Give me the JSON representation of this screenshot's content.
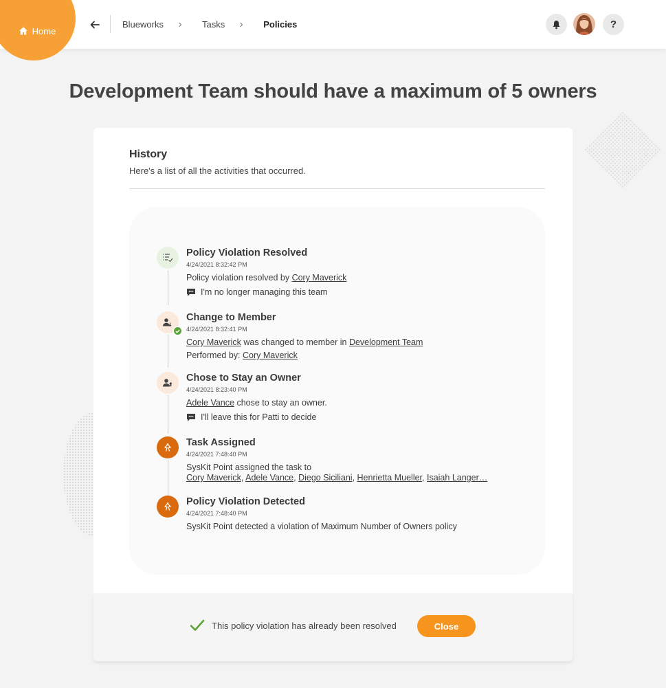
{
  "header": {
    "home_label": "Home",
    "breadcrumbs": [
      "Blueworks",
      "Tasks",
      "Policies"
    ],
    "help_label": "?"
  },
  "page": {
    "title": "Development Team should have a maximum of 5 owners"
  },
  "history": {
    "title": "History",
    "subtitle": "Here's a list of all the activities that occurred.",
    "events": [
      {
        "title": "Policy Violation Resolved",
        "time": "4/24/2021 8:32:42 PM",
        "text": "Policy violation resolved by",
        "user": "Cory Maverick",
        "comment": "I'm no longer managing this team",
        "icon": "policy-list-check-icon"
      },
      {
        "title": "Change to Member",
        "time": "4/24/2021 8:32:41 PM",
        "user": "Cory Maverick",
        "text": "was changed to member in",
        "team": "Development Team",
        "performed_label": "Performed by:",
        "performed_user": "Cory Maverick",
        "icon": "user-change-icon"
      },
      {
        "title": "Chose to Stay an Owner",
        "time": "4/24/2021 8:23:40 PM",
        "user": "Adele Vance",
        "text": "chose to stay an owner.",
        "comment": "I'll leave this for Patti to decide",
        "icon": "user-owner-icon"
      },
      {
        "title": "Task Assigned",
        "time": "4/24/2021 7:48:40 PM",
        "text": "SysKit Point assigned the task to",
        "users": [
          "Cory Maverick",
          "Adele Vance",
          "Diego Siciliani",
          "Henrietta Mueller",
          "Isaiah Langer…"
        ],
        "icon": "syskit-icon"
      },
      {
        "title": "Policy Violation Detected",
        "time": "4/24/2021 7:48:40 PM",
        "text": "SysKit Point detected a violation of Maximum Number of Owners policy",
        "icon": "syskit-icon"
      }
    ]
  },
  "footer": {
    "status_text": "This policy violation has already been resolved",
    "close_label": "Close"
  },
  "colors": {
    "accent": "#f7941d",
    "home_blob": "#f7a035",
    "syskit_orange": "#d96a0e",
    "success_green": "#5ba236"
  }
}
